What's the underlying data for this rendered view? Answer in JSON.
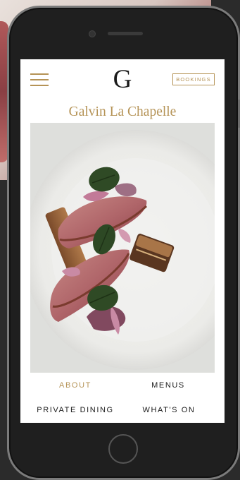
{
  "app": {
    "logo_mark": "G",
    "title": "Galvin La Chapelle",
    "bookings_label": "BOOKINGS"
  },
  "nav": {
    "items": [
      {
        "label": "ABOUT",
        "active": true
      },
      {
        "label": "MENUS",
        "active": false
      },
      {
        "label": "PRIVATE DINING",
        "active": false
      },
      {
        "label": "WHAT'S ON",
        "active": false
      }
    ]
  },
  "colors": {
    "accent": "#b59356",
    "text": "#1a1a1a",
    "phone_body": "#1f1f1f",
    "background": "#2b2b2b"
  },
  "icons": {
    "menu": "hamburger-icon"
  }
}
